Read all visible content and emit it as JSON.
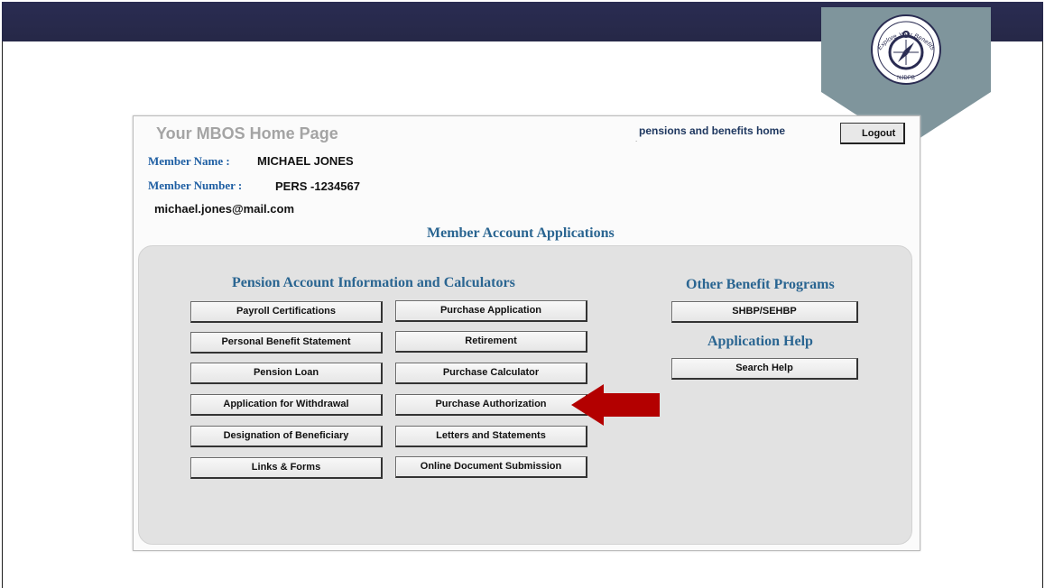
{
  "header": {
    "title": "Your MBOS Home Page",
    "pensions_link": "pensions and benefits home",
    "logout_label": "Logout",
    "badge": {
      "ring_text": "Explore Your Benefits",
      "bottom_text": "NJDPB",
      "band_color": "#7f959c",
      "top_color": "#282a4d"
    }
  },
  "member": {
    "name_label": "Member Name :",
    "name": "MICHAEL JONES",
    "number_label": "Member Number :",
    "number": "PERS -1234567",
    "email": "michael.jones@mail.com"
  },
  "apps_title": "Member Account Applications",
  "pension": {
    "title": "Pension Account Information and Calculators",
    "col1": [
      "Payroll Certifications",
      "Personal Benefit Statement",
      "Pension Loan",
      "Application for Withdrawal",
      "Designation of Beneficiary",
      "Links & Forms"
    ],
    "col2": [
      "Purchase Application",
      "Retirement",
      "Purchase Calculator",
      "Purchase Authorization",
      "Letters and Statements",
      "Online Document Submission"
    ]
  },
  "other": {
    "title": "Other Benefit Programs",
    "button": "SHBP/SEHBP"
  },
  "help": {
    "title": "Application Help",
    "button": "Search Help"
  },
  "highlight": {
    "target": "Purchase Authorization",
    "color": "#b30000"
  }
}
